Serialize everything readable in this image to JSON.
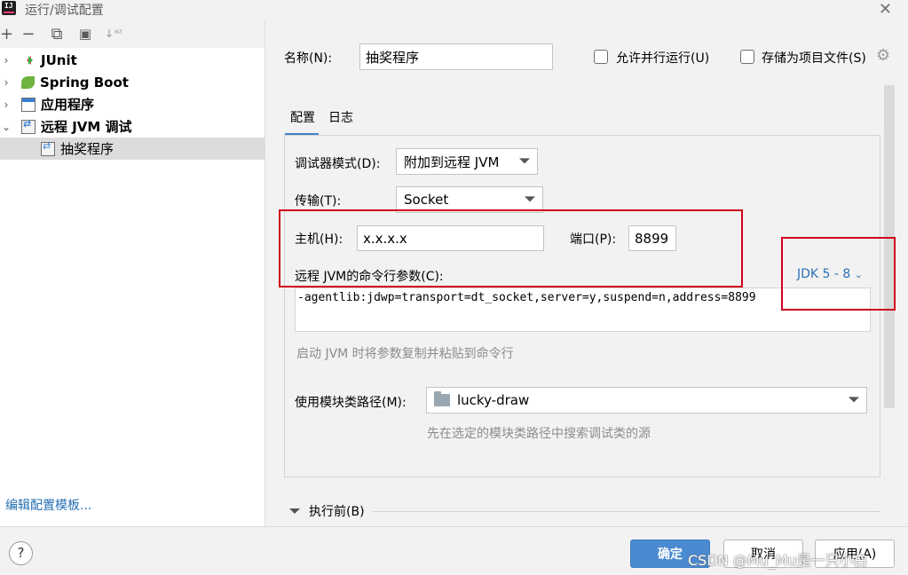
{
  "window": {
    "title": "运行/调试配置",
    "app_icon_text": "IJ"
  },
  "sidebar": {
    "toolbar": [
      {
        "name": "add-icon",
        "glyph": "+"
      },
      {
        "name": "remove-icon",
        "glyph": "−"
      },
      {
        "name": "copy-icon",
        "glyph": "⧉"
      },
      {
        "name": "folder-add-icon",
        "glyph": "▣"
      },
      {
        "name": "sort-icon",
        "glyph": "↓ᵃᶻ"
      }
    ],
    "tree": [
      {
        "label": "JUnit",
        "chevron": "›"
      },
      {
        "label": "Spring Boot",
        "chevron": "›"
      },
      {
        "label": "应用程序",
        "chevron": "›"
      },
      {
        "label": "远程 JVM 调试",
        "chevron": "⌄"
      },
      {
        "label": "抽奖程序"
      }
    ],
    "edit_templates_link": "编辑配置模板..."
  },
  "main": {
    "name_label": "名称(N):",
    "name_value": "抽奖程序",
    "allow_parallel_label": "允许并行运行(U)",
    "store_as_project_file_label": "存储为项目文件(S)",
    "tabs": [
      {
        "label": "配置",
        "active": true
      },
      {
        "label": "日志",
        "active": false
      }
    ],
    "debugger_mode_label": "调试器模式(D):",
    "debugger_mode_value": "附加到远程 JVM",
    "transport_label": "传输(T):",
    "transport_value": "Socket",
    "host_label": "主机(H):",
    "host_value": "x.x.x.x",
    "port_label": "端口(P):",
    "port_value": "8899",
    "cmd_args_label": "远程 JVM的命令行参数(C):",
    "jdk_selector": "JDK 5 - 8",
    "cmd_args_value": "-agentlib:jdwp=transport=dt_socket,server=y,suspend=n,address=8899",
    "cmd_args_hint": "启动 JVM 时将参数复制并粘贴到命令行",
    "module_classpath_label": "使用模块类路径(M):",
    "module_classpath_value": "lucky-draw",
    "module_classpath_hint": "先在选定的模块类路径中搜索调试类的源",
    "before_launch_label": "执行前(B)"
  },
  "footer": {
    "help_label": "?",
    "ok_label": "确定",
    "cancel_label": "取消",
    "apply_label": "应用(A)",
    "watermark": "CSDN @Mu_Mu是一只小白"
  },
  "colors": {
    "accent": "#4a8ad0",
    "link": "#2f70b5",
    "highlight_box": "#d0021b",
    "selected_row": "#dcdcdc"
  }
}
